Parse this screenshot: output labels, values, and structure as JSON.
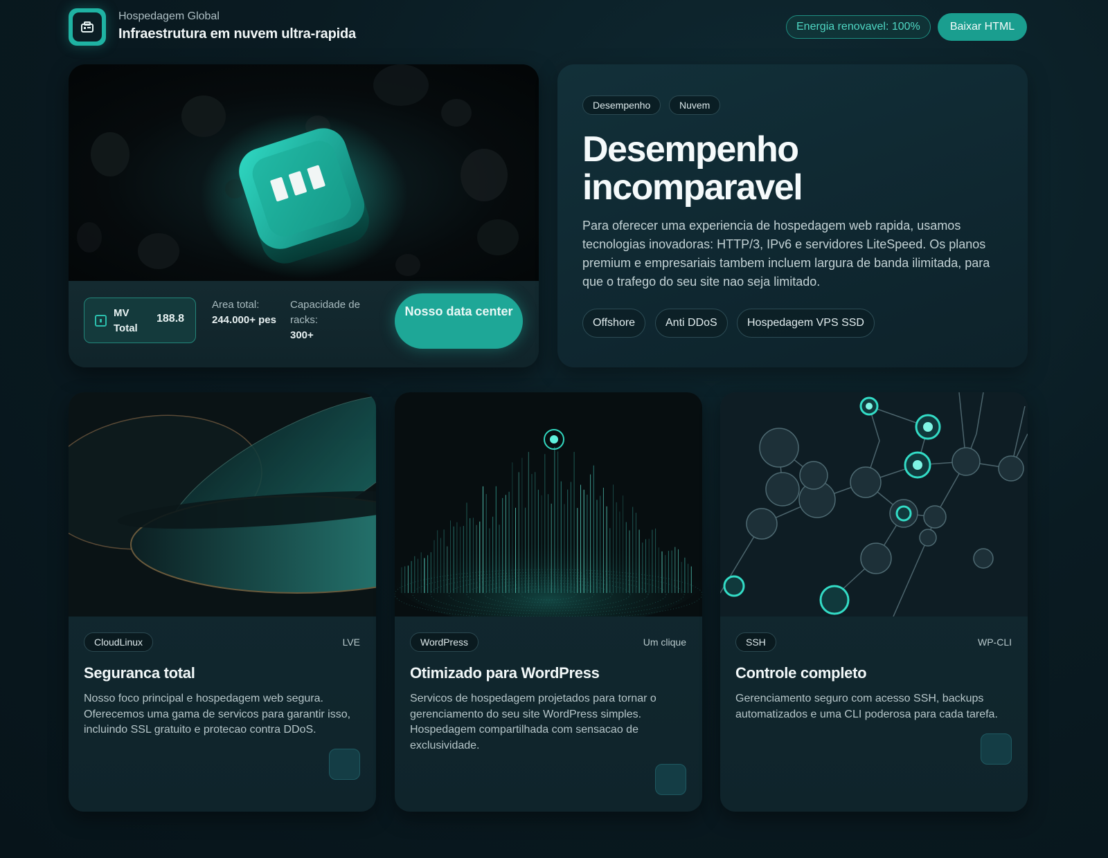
{
  "header": {
    "brand_subtitle": "Hospedagem Global",
    "brand_title": "Infraestrutura em nuvem ultra-rapida",
    "energy_badge": "Energia renovavel: 100%",
    "download_label": "Baixar HTML",
    "brand_icon": "server-icon"
  },
  "hero": {
    "mv_label": "MV Total",
    "mv_value": "188.8",
    "area_label": "Area total:",
    "area_value": "244.000+ pes",
    "racks_label": "Capacidade de racks:",
    "racks_value": "300+",
    "datacenter_button": "Nosso data center"
  },
  "performance": {
    "tags": [
      "Desempenho",
      "Nuvem"
    ],
    "title": "Desempenho incomparavel",
    "description": "Para oferecer uma experiencia de hospedagem web rapida, usamos tecnologias inovadoras: HTTP/3, IPv6 e servidores LiteSpeed. Os planos premium e empresariais tambem incluem largura de banda ilimitada, para que o trafego do seu site nao seja limitado.",
    "chips": [
      "Offshore",
      "Anti DDoS",
      "Hospedagem VPS SSD"
    ]
  },
  "features": [
    {
      "badge": "CloudLinux",
      "meta": "LVE",
      "title": "Seguranca total",
      "description": "Nosso foco principal e hospedagem web segura. Oferecemos uma gama de servicos para garantir isso, incluindo SSL gratuito e protecao contra DDoS."
    },
    {
      "badge": "WordPress",
      "meta": "Um clique",
      "title": "Otimizado para WordPress",
      "description": "Servicos de hospedagem projetados para tornar o gerenciamento do seu site WordPress simples. Hospedagem compartilhada com sensacao de exclusividade."
    },
    {
      "badge": "SSH",
      "meta": "WP-CLI",
      "title": "Controle completo",
      "description": "Gerenciamento seguro com acesso SSH, backups automatizados e uma CLI poderosa para cada tarefa."
    }
  ],
  "colors": {
    "accent": "#1ea797",
    "accent_light": "#4fd8c4",
    "background": "#0a1b22",
    "card": "#123039"
  }
}
